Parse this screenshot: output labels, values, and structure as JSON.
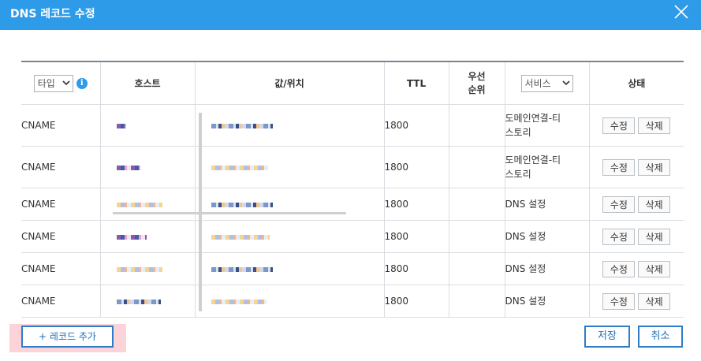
{
  "dialog": {
    "title": "DNS 레코드 수정",
    "close_icon": "close-icon"
  },
  "colors": {
    "header": "#2e9be8",
    "accent": "#2e7ec7",
    "highlight": "#fbd3d8"
  },
  "table": {
    "type_filter": "타입",
    "info_icon": "i",
    "headers": {
      "host": "호스트",
      "value": "값/위치",
      "ttl": "TTL",
      "priority_line1": "우선",
      "priority_line2": "순위",
      "status": "상태"
    },
    "service_filter": "서비스",
    "rows": [
      {
        "type": "CNAME",
        "ttl": "1800",
        "service_line1": "도메인연결-티",
        "service_line2": "스토리",
        "edit": "수정",
        "delete": "삭제"
      },
      {
        "type": "CNAME",
        "ttl": "1800",
        "service_line1": "도메인연결-티",
        "service_line2": "스토리",
        "edit": "수정",
        "delete": "삭제"
      },
      {
        "type": "CNAME",
        "ttl": "1800",
        "service_line1": "DNS 설정",
        "service_line2": "",
        "edit": "수정",
        "delete": "삭제"
      },
      {
        "type": "CNAME",
        "ttl": "1800",
        "service_line1": "DNS 설정",
        "service_line2": "",
        "edit": "수정",
        "delete": "삭제"
      },
      {
        "type": "CNAME",
        "ttl": "1800",
        "service_line1": "DNS 설정",
        "service_line2": "",
        "edit": "수정",
        "delete": "삭제"
      },
      {
        "type": "CNAME",
        "ttl": "1800",
        "service_line1": "DNS 설정",
        "service_line2": "",
        "edit": "수정",
        "delete": "삭제"
      }
    ]
  },
  "footer": {
    "add_record": "+ 레코드 추가",
    "save": "저장",
    "cancel": "취소"
  }
}
